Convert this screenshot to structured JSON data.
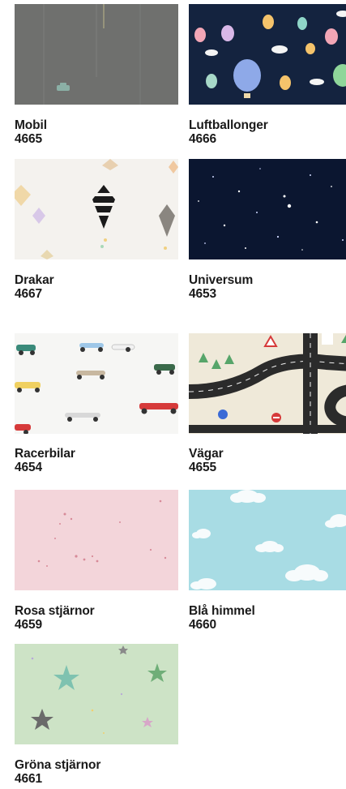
{
  "items": [
    {
      "name": "Mobil",
      "code": "4665"
    },
    {
      "name": "Luftballonger",
      "code": "4666"
    },
    {
      "name": "Drakar",
      "code": "4667"
    },
    {
      "name": "Universum",
      "code": "4653"
    },
    {
      "name": "Racerbilar",
      "code": "4654"
    },
    {
      "name": "Vägar",
      "code": "4655"
    },
    {
      "name": "Rosa stjärnor",
      "code": "4659"
    },
    {
      "name": "Blå himmel",
      "code": "4660"
    },
    {
      "name": "Gröna stjärnor",
      "code": "4661"
    }
  ],
  "colors": {
    "mobil": "#6f706e",
    "luftballonger": "#14233f",
    "drakar": "#f4f2ee",
    "universum": "#0b1630",
    "racerbilar": "#f6f6f4",
    "vagar": "#efe9d9",
    "rosa": "#f3d5da",
    "bla": "#a8dce4",
    "grona": "#cde3c6"
  }
}
